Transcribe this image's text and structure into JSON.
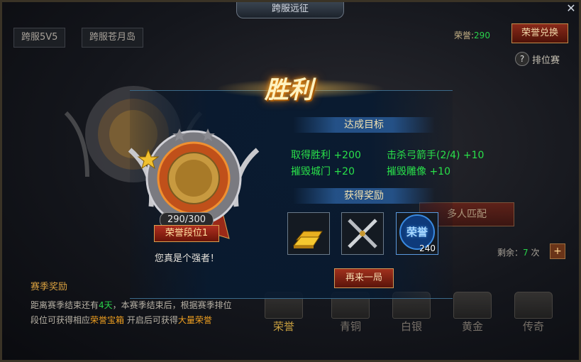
{
  "window": {
    "title": "跨服远征",
    "close": "✕"
  },
  "tabs": [
    "跨服5V5",
    "跨服苍月岛"
  ],
  "honor": {
    "label": "荣誉:",
    "value": "290",
    "exchange_button": "荣誉兑换"
  },
  "ranked": {
    "help": "?",
    "label": "排位赛"
  },
  "match_button": "多人匹配",
  "remaining": {
    "label": "剩余：",
    "count": "7",
    "unit": "次",
    "plus": "+"
  },
  "season": {
    "title": "赛季奖励",
    "line1_a": "距离赛季结束还有",
    "line1_days": "4天",
    "line1_b": "，本赛季结束后，根据赛季排位",
    "line2_a": "段位可获得相应",
    "line2_chest": "荣誉宝箱",
    "line2_b": " 开启后可获得",
    "line2_reward": "大量荣誉"
  },
  "chests": [
    "荣誉",
    "青铜",
    "白银",
    "黄金",
    "传奇"
  ],
  "result": {
    "title": "胜利",
    "goals_title": "达成目标",
    "goals": [
      "取得胜利 +200",
      "击杀弓箭手(2/4) +10",
      "摧毁城门 +20",
      "摧毁雕像 +10"
    ],
    "rewards_title": "获得奖励",
    "reward_icons": [
      "gold-bar-icon",
      "crossed-swords-icon",
      "honor-badge-icon"
    ],
    "honor_badge_text": "荣誉",
    "honor_count": "240",
    "again_button": "再来一局",
    "medal_score": "290/300",
    "medal_rank": "荣誉段位1",
    "praise": "您真是个强者！"
  },
  "colors": {
    "green": "#29d24a",
    "orange": "#f0a020",
    "accent": "#f0d7a8"
  }
}
